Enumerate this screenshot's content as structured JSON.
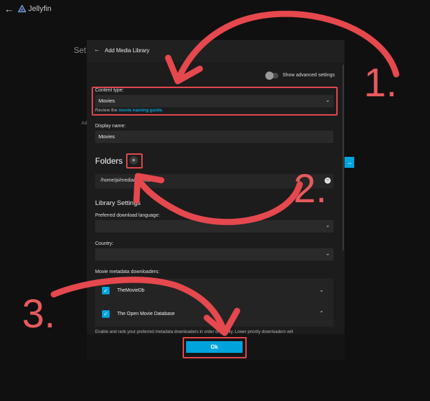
{
  "app": {
    "brand": "Jellyfin"
  },
  "background": {
    "title_fragment": "Set",
    "side_fragment": "Ad",
    "button_arrow": "→"
  },
  "dialog": {
    "title": "Add Media Library",
    "advanced_toggle_label": "Show advanced settings",
    "content_type": {
      "label": "Content type:",
      "value": "Movies",
      "help_prefix": "Review the ",
      "help_link": "movie naming guide."
    },
    "display_name": {
      "label": "Display name:",
      "value": "Movies"
    },
    "folders": {
      "heading": "Folders",
      "add_label": "+",
      "path": "/home/pi/media/movies"
    },
    "library_settings": {
      "heading": "Library Settings",
      "language_label": "Preferred download language:",
      "language_value": "",
      "country_label": "Country:",
      "country_value": ""
    },
    "metadata": {
      "label": "Movie metadata downloaders:",
      "items": [
        {
          "name": "TheMovieDb",
          "checked": true
        },
        {
          "name": "The Open Movie Database",
          "checked": true
        }
      ],
      "description": "Enable and rank your preferred metadata downloaders in order of priority. Lower priority downloaders will"
    },
    "ok_label": "Ok"
  },
  "annotations": {
    "step1": "1.",
    "step2": "2.",
    "step3": "3."
  },
  "colors": {
    "accent": "#00a4dc",
    "annotation": "#e5484d",
    "background": "#101010",
    "dialog": "#1c1c1c"
  },
  "icons": [
    "back-arrow-icon",
    "jellyfin-logo-icon",
    "chevron-down-icon",
    "chevron-up-icon",
    "plus-icon",
    "remove-icon",
    "checkbox-icon"
  ]
}
